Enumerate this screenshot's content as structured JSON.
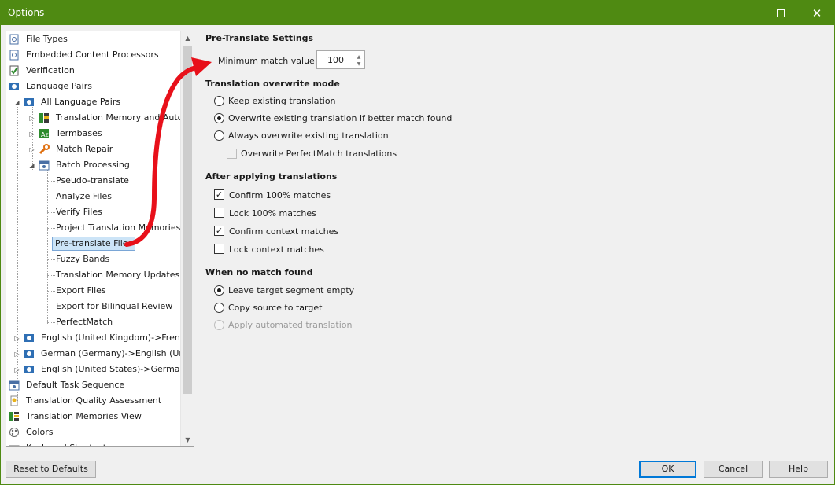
{
  "window": {
    "title": "Options"
  },
  "tree": {
    "items": [
      {
        "label": "File Types",
        "icon": "file-types-icon"
      },
      {
        "label": "Embedded Content Processors",
        "icon": "embedded-icon"
      },
      {
        "label": "Verification",
        "icon": "verification-icon"
      },
      {
        "label": "Language Pairs",
        "icon": "language-pairs-icon"
      },
      {
        "label": "All Language Pairs",
        "icon": "language-pairs-icon"
      },
      {
        "label": "Translation Memory and Autom",
        "icon": "translation-memory-icon"
      },
      {
        "label": "Termbases",
        "icon": "termbase-icon"
      },
      {
        "label": "Match Repair",
        "icon": "wrench-icon"
      },
      {
        "label": "Batch Processing",
        "icon": "batch-icon"
      },
      {
        "label": "Pseudo-translate"
      },
      {
        "label": "Analyze Files"
      },
      {
        "label": "Verify Files"
      },
      {
        "label": "Project Translation Memories"
      },
      {
        "label": "Pre-translate Files"
      },
      {
        "label": "Fuzzy Bands"
      },
      {
        "label": "Translation Memory Updates"
      },
      {
        "label": "Export Files"
      },
      {
        "label": "Export for Bilingual Review"
      },
      {
        "label": "PerfectMatch"
      },
      {
        "label": "English (United Kingdom)->French",
        "icon": "language-pairs-icon"
      },
      {
        "label": "German (Germany)->English (Unite",
        "icon": "language-pairs-icon"
      },
      {
        "label": "English (United States)->German (",
        "icon": "language-pairs-icon"
      },
      {
        "label": "Default Task Sequence",
        "icon": "batch-icon"
      },
      {
        "label": "Translation Quality Assessment",
        "icon": "tqa-icon"
      },
      {
        "label": "Translation Memories View",
        "icon": "translation-memory-icon"
      },
      {
        "label": "Colors",
        "icon": "palette-icon"
      },
      {
        "label": "Keyboard Shortcuts",
        "icon": "keyboard-icon"
      }
    ]
  },
  "settings": {
    "heading": "Pre-Translate Settings",
    "min_match_label": "Minimum match value:",
    "min_match_value": "100",
    "overwrite": {
      "heading": "Translation overwrite mode",
      "options": [
        "Keep existing translation",
        "Overwrite existing translation if better match found",
        "Always overwrite existing translation"
      ],
      "selected": 1,
      "perfectmatch_label": "Overwrite PerfectMatch translations"
    },
    "after": {
      "heading": "After applying translations",
      "confirm100": "Confirm 100% matches",
      "lock100": "Lock 100% matches",
      "confirmcontext": "Confirm context matches",
      "lockcontext": "Lock context matches"
    },
    "nomatch": {
      "heading": "When no match found",
      "options": [
        "Leave target segment empty",
        "Copy source to target",
        "Apply automated translation"
      ],
      "selected": 0
    }
  },
  "buttons": {
    "reset": "Reset to Defaults",
    "ok": "OK",
    "cancel": "Cancel",
    "help": "Help"
  },
  "colors": {
    "titlebar": "#4f8a12",
    "annotation_arrow": "#e8101a"
  }
}
